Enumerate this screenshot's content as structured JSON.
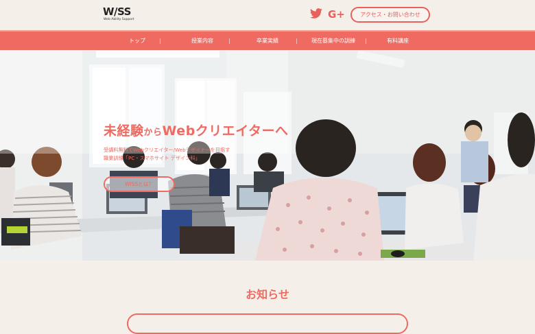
{
  "header": {
    "logo_mark": "W/SS",
    "logo_tagline": "Web Ability Support",
    "contact_label": "アクセス・お問い合わせ"
  },
  "social": {
    "twitter_icon": "twitter-icon",
    "google_plus_icon": "google-plus-icon",
    "google_plus_glyph": "G+"
  },
  "nav": {
    "items": [
      {
        "label": "トップ"
      },
      {
        "label": "授業内容"
      },
      {
        "label": "卒業実績"
      },
      {
        "label": "現在募集中の訓練"
      },
      {
        "label": "有料講座"
      }
    ]
  },
  "hero": {
    "title_main_1": "未経験",
    "title_small": "から",
    "title_main_2": "Webクリエイターへ",
    "subtitle_line1": "受講料無料でWebクリエイター/Webデザイナーを目指す",
    "subtitle_line2": "職業訓練「PC・スマホサイト デザイン科」",
    "cta_label": "WISSとは？"
  },
  "news": {
    "title": "お知らせ"
  },
  "colors": {
    "accent": "#ef6a61",
    "background": "#f4efe9"
  }
}
